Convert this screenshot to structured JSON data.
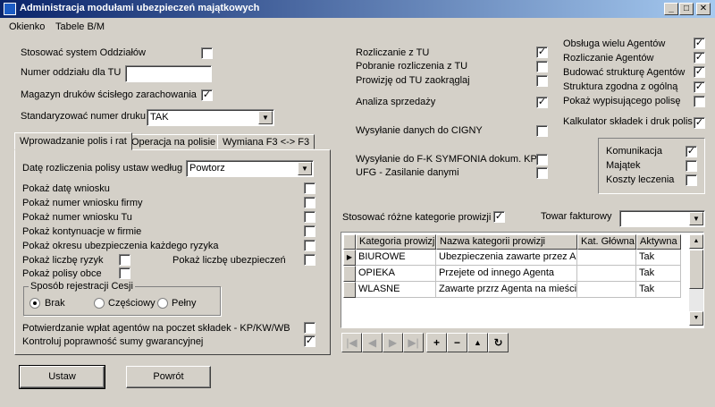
{
  "window": {
    "title": "Administracja modułami ubezpieczeń majątkowych",
    "buttons": [
      "_",
      "□",
      "✕"
    ]
  },
  "menu": [
    "Okienko",
    "Tabele B/M"
  ],
  "left": {
    "use_branch_system": {
      "label": "Stosować system Oddziałów",
      "checked": false
    },
    "branch_number": {
      "label": "Numer oddziału dla TU",
      "value": ""
    },
    "closing_warehouse": {
      "label": "Magazyn druków ścisłego zarachowania",
      "checked": true
    },
    "standardize": {
      "label": "Standaryzować numer druku",
      "value": "TAK"
    }
  },
  "tabs": [
    "Wprowadzanie polis i rat",
    "Operacja na polisie",
    "Wymiana  F3 <-> F3"
  ],
  "tab_panel": {
    "date_label": "Datę rozliczenia polisy ustaw według",
    "date_value": "Powtorz",
    "checks": [
      {
        "label": "Pokaż datę wniosku",
        "checked": false
      },
      {
        "label": "Pokaż numer wniosku firmy",
        "checked": false
      },
      {
        "label": "Pokaż numer wniosku Tu",
        "checked": false
      },
      {
        "label": "Pokaż kontynuacje w firmie",
        "checked": false
      },
      {
        "label": "Pokaż okresu ubezpieczenia każdego ryzyka",
        "checked": false
      }
    ],
    "risk_count": {
      "label": "Pokaż liczbę ryzyk",
      "checked": false
    },
    "insured_count": {
      "label": "Pokaż liczbę ubezpieczeń",
      "checked": false
    },
    "foreign_policies": {
      "label": "Pokaż polisy obce",
      "checked": false
    },
    "registration_group": {
      "title": "Sposób rejestracji Cesji",
      "options": [
        "Brak",
        "Częściowy",
        "Pełny"
      ],
      "selected": "Brak"
    },
    "confirm_payments": {
      "label": "Potwierdzanie wpłat agentów na poczet składek - KP/KW/WB",
      "checked": false
    },
    "control_sum": {
      "label": "Kontroluj poprawność sumy gwarancyjnej",
      "checked": true
    }
  },
  "buttons": {
    "set": "Ustaw",
    "back": "Powrót"
  },
  "middle": [
    {
      "label": "Rozliczanie z TU",
      "checked": true
    },
    {
      "label": "Pobranie rozliczenia z TU",
      "checked": false
    },
    {
      "label": "Prowizję od TU zaokrąglaj",
      "checked": false
    },
    {
      "label": "Analiza sprzedaży",
      "checked": true
    },
    {
      "label": "Wysyłanie danych do CIGNY",
      "checked": false
    },
    {
      "label": "Wysyłanie do F-K SYMFONIA dokum. KP",
      "checked": false
    },
    {
      "label": "UFG - Zasilanie danymi",
      "checked": false
    }
  ],
  "right": [
    {
      "label": "Obsługa wielu Agentów",
      "checked": true
    },
    {
      "label": "Rozliczanie Agentów",
      "checked": true
    },
    {
      "label": "Budować strukturę Agentów",
      "checked": true
    },
    {
      "label": "Struktura zgodna z ogólną",
      "checked": true
    },
    {
      "label": "Pokaż wypisującego polisę",
      "checked": false
    },
    {
      "label": "Kalkulator składek i druk polis",
      "checked": true
    }
  ],
  "module_box": [
    {
      "label": "Komunikacja",
      "checked": true
    },
    {
      "label": "Majątek",
      "checked": false
    },
    {
      "label": "Koszty leczenia",
      "checked": false
    }
  ],
  "commission": {
    "label": "Stosować różne kategorie prowizji",
    "checked": true
  },
  "invoice_goods": {
    "label": "Towar fakturowy",
    "value": ""
  },
  "grid": {
    "columns": [
      "Kategoria prowizji",
      "Nazwa kategorii prowizji",
      "Kat. Główna",
      "Aktywna"
    ],
    "rows": [
      [
        "BIUROWE",
        "Ubezpieczenia zawarte przez Ag",
        "",
        "Tak"
      ],
      [
        "OPIEKA",
        "Przejete od innego Agenta",
        "",
        "Tak"
      ],
      [
        "WLASNE",
        "Zawarte przrz Agenta na mieście",
        "",
        "Tak"
      ]
    ]
  },
  "navigator": [
    "first",
    "prior",
    "next",
    "last",
    "insert",
    "delete",
    "edit",
    "refresh"
  ]
}
